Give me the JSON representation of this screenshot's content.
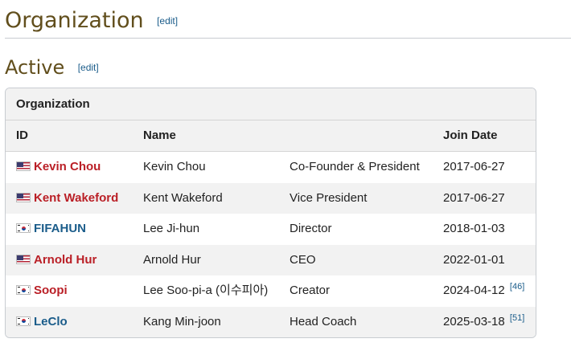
{
  "section": {
    "title": "Organization",
    "edit": "[edit]"
  },
  "subsection": {
    "title": "Active",
    "edit": "[edit]"
  },
  "table": {
    "caption": "Organization",
    "headers": {
      "id": "ID",
      "name": "Name",
      "role": "",
      "date": "Join Date"
    },
    "rows": [
      {
        "flag": "us-flag-icon",
        "id": "Kevin Chou",
        "id_color": "#ba1f26",
        "name": "Kevin Chou",
        "role": "Co-Founder & President",
        "date": "2017-06-27",
        "ref": ""
      },
      {
        "flag": "us-flag-icon",
        "id": "Kent Wakeford",
        "id_color": "#ba1f26",
        "name": "Kent Wakeford",
        "role": "Vice President",
        "date": "2017-06-27",
        "ref": ""
      },
      {
        "flag": "kr-flag-icon",
        "id": "FIFAHUN",
        "id_color": "#1a5c8a",
        "name": "Lee Ji-hun",
        "role": "Director",
        "date": "2018-01-03",
        "ref": ""
      },
      {
        "flag": "us-flag-icon",
        "id": "Arnold Hur",
        "id_color": "#ba1f26",
        "name": "Arnold Hur",
        "role": "CEO",
        "date": "2022-01-01",
        "ref": ""
      },
      {
        "flag": "kr-flag-icon",
        "id": "Soopi",
        "id_color": "#ba1f26",
        "name": "Lee Soo-pi-a (이수피아)",
        "role": "Creator",
        "date": "2024-04-12",
        "ref": "[46]"
      },
      {
        "flag": "kr-flag-icon",
        "id": "LeClo",
        "id_color": "#1a5c8a",
        "name": "Kang Min-joon",
        "role": "Head Coach",
        "date": "2025-03-18",
        "ref": "[51]"
      }
    ]
  },
  "colors": {
    "heading": "#614e1c",
    "link": "#1a5c8a",
    "red_link": "#ba1f26",
    "header_bg": "#f2f2f2"
  }
}
